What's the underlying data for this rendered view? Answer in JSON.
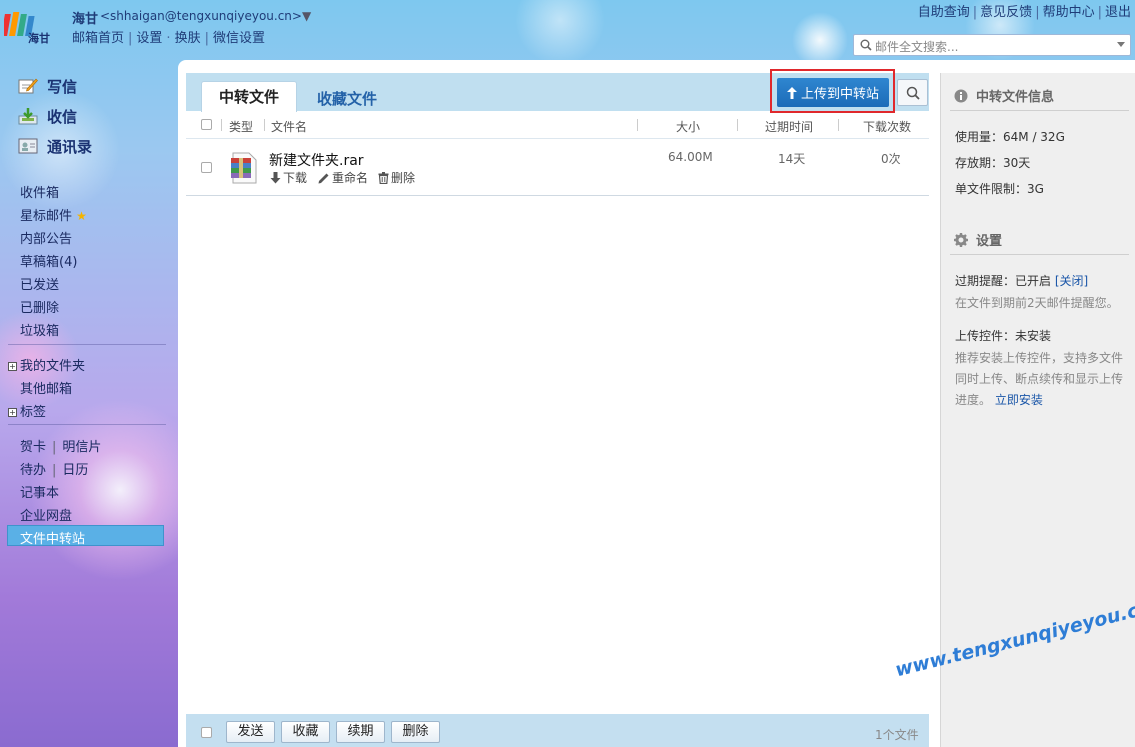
{
  "header": {
    "user_name": "海甘",
    "user_email": "<shhaigan@tengxunqiyeyou.cn>",
    "email_dropdown": "▼",
    "links": [
      "邮箱首页",
      "设置",
      "换肤",
      "微信设置"
    ],
    "top_links": [
      "自助查询",
      "意见反馈",
      "帮助中心",
      "退出"
    ],
    "search_placeholder": "邮件全文搜索..."
  },
  "sidebar": {
    "primary": [
      {
        "label": "写信",
        "icon": "compose-icon"
      },
      {
        "label": "收信",
        "icon": "inbox-download-icon"
      },
      {
        "label": "通讯录",
        "icon": "contacts-icon"
      }
    ],
    "folders": [
      "收件箱",
      "星标邮件",
      "内部公告",
      "草稿箱(4)",
      "已发送",
      "已删除",
      "垃圾箱"
    ],
    "my_folders": "我的文件夹",
    "other_mailboxes": "其他邮箱",
    "tags": "标签",
    "tools": {
      "greeting_card": "贺卡",
      "postcard": "明信片",
      "todo": "待办",
      "calendar": "日历",
      "notebook": "记事本",
      "netdisk": "企业网盘",
      "transfer": "文件中转站"
    }
  },
  "main": {
    "tabs": [
      "中转文件",
      "收藏文件"
    ],
    "upload_button": "上传到中转站",
    "columns": [
      "类型",
      "文件名",
      "大小",
      "过期时间",
      "下载次数"
    ],
    "files": [
      {
        "name": "新建文件夹.rar",
        "size": "64.00M",
        "expires": "14天",
        "downloads": "0次",
        "actions": [
          "下载",
          "重命名",
          "删除"
        ]
      }
    ],
    "footer_buttons": [
      "发送",
      "收藏",
      "续期",
      "删除"
    ],
    "count": "1个文件"
  },
  "info_panel": {
    "title": "中转文件信息",
    "usage": "使用量：64M / 32G",
    "retention": "存放期：30天",
    "file_limit": "单文件限制：3G",
    "settings_title": "设置",
    "expiry_reminder": "过期提醒：已开启",
    "close_link": "[关闭]",
    "expiry_desc": "在文件到期前2天邮件提醒您。",
    "plugin_status": "上传控件：未安装",
    "plugin_desc": "推荐安装上传控件，支持多文件同时上传、断点续传和显示上传进度。",
    "install_link": "立即安装"
  },
  "watermark": "www.tengxunqiyeyou.com",
  "colors": {
    "accent": "#1c6bb8",
    "highlight": "#e0282c",
    "active_nav": "#5ab0e6"
  }
}
